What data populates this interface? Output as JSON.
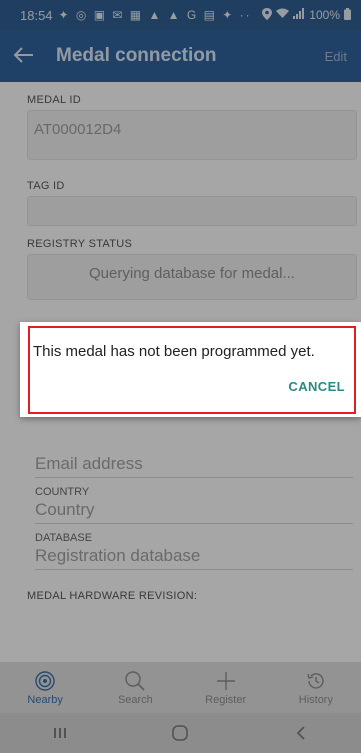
{
  "status_bar": {
    "time": "18:54",
    "notification_icons": "✦ ◎ ▣ ✉ ▦ ▲ ▲ G ▤ ✦ ··",
    "right_text": "100%",
    "icon_names": [
      "location-icon",
      "wifi-icon",
      "signal-icon",
      "battery-icon"
    ]
  },
  "app_bar": {
    "title": "Medal connection",
    "edit_label": "Edit"
  },
  "form": {
    "medal_id_label": "MEDAL ID",
    "medal_id_value": "AT000012D4",
    "tag_id_label": "TAG ID",
    "tag_id_value": "",
    "registry_status_label": "REGISTRY STATUS",
    "registry_status_value": "Querying database for medal...",
    "email_placeholder": "Email address",
    "country_label": "COUNTRY",
    "country_placeholder": "Country",
    "database_label": "DATABASE",
    "database_placeholder": "Registration database",
    "hardware_revision_label": "MEDAL HARDWARE REVISION:"
  },
  "dialog": {
    "message": "This medal has not been programmed yet.",
    "cancel_label": "CANCEL"
  },
  "bottom_nav": [
    {
      "label": "Nearby",
      "icon": "radar-icon",
      "active": true
    },
    {
      "label": "Search",
      "icon": "search-icon",
      "active": false
    },
    {
      "label": "Register",
      "icon": "plus-icon",
      "active": false
    },
    {
      "label": "History",
      "icon": "history-icon",
      "active": false
    }
  ],
  "colors": {
    "app_bar": "#2f6199",
    "accent": "#2a8b84",
    "highlight_border": "#e02020"
  }
}
